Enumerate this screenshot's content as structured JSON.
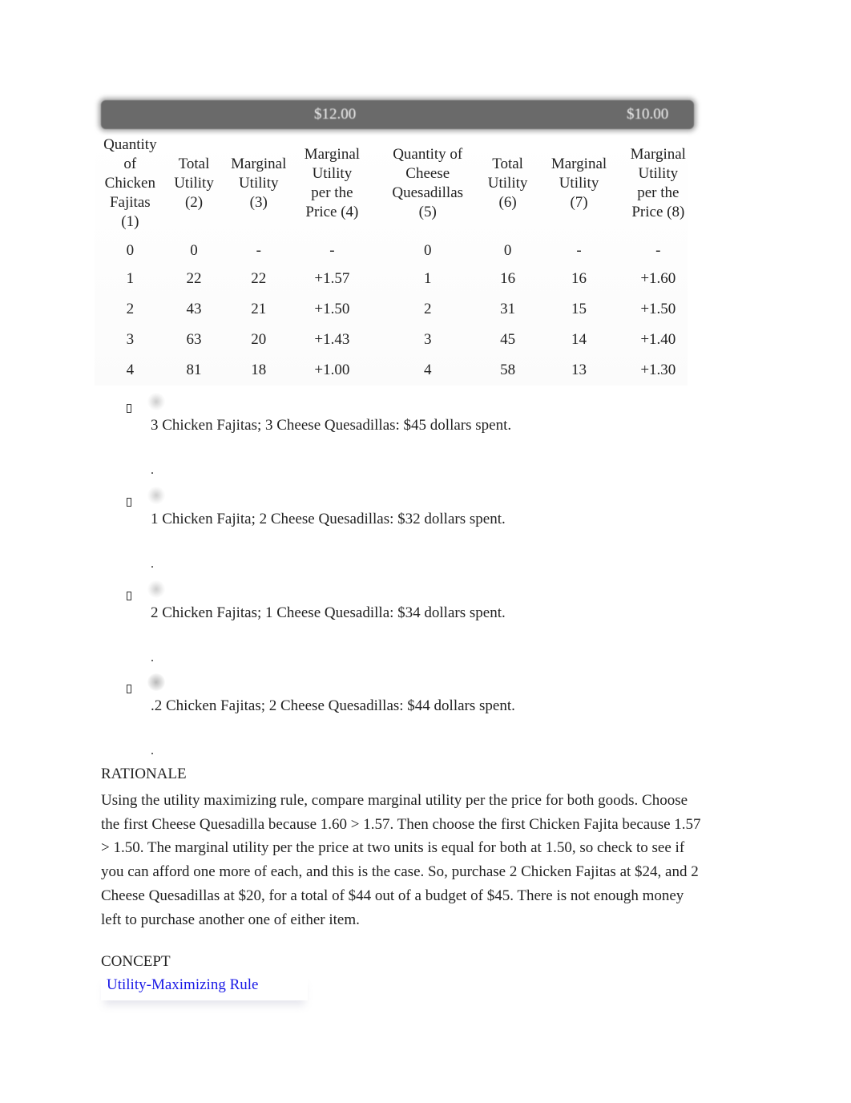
{
  "table": {
    "prices": {
      "fajitas": "$12.00",
      "quesadillas": "$10.00"
    },
    "headers": [
      "Quantity of Chicken Fajitas (1)",
      "Total Utility (2)",
      "Marginal Utility (3)",
      "Marginal Utility per the Price (4)",
      "Quantity of Cheese Quesadillas (5)",
      "Total Utility (6)",
      "Marginal Utility (7)",
      "Marginal Utility per the Price (8)"
    ],
    "header_lines": [
      [
        "Quantity",
        "of",
        "Chicken",
        "Fajitas",
        "(1)"
      ],
      [
        "Total",
        "Utility",
        "(2)"
      ],
      [
        "Marginal",
        "Utility",
        "(3)"
      ],
      [
        "Marginal",
        "Utility",
        "per the",
        "Price (4)"
      ],
      [
        "Quantity of",
        "Cheese",
        "Quesadillas",
        "(5)"
      ],
      [
        "Total",
        "Utility",
        "(6)"
      ],
      [
        "Marginal",
        "Utility",
        "(7)"
      ],
      [
        "Marginal",
        "Utility",
        "per the",
        "Price (8)"
      ]
    ],
    "rows": [
      [
        "0",
        "0",
        "-",
        "-",
        "0",
        "0",
        "-",
        "-"
      ],
      [
        "1",
        "22",
        "22",
        "+1.57",
        "1",
        "16",
        "16",
        "+1.60"
      ],
      [
        "2",
        "43",
        "21",
        "+1.50",
        "2",
        "31",
        "15",
        "+1.50"
      ],
      [
        "3",
        "63",
        "20",
        "+1.43",
        "3",
        "45",
        "14",
        "+1.40"
      ],
      [
        "4",
        "81",
        "18",
        "+1.00",
        "4",
        "58",
        "13",
        "+1.30"
      ]
    ]
  },
  "options": [
    {
      "text": "3 Chicken Fajitas; 3 Cheese Quesadillas: $45 dollars spent.",
      "trailing": "."
    },
    {
      "text": "1 Chicken Fajita; 2 Cheese Quesadillas: $32 dollars spent.",
      "trailing": "."
    },
    {
      "text": "2 Chicken Fajitas; 1 Cheese Quesadilla: $34 dollars spent.",
      "trailing": "."
    },
    {
      "text": ".2 Chicken Fajitas; 2 Cheese Quesadillas: $44 dollars spent.",
      "trailing": "."
    }
  ],
  "rationale": {
    "heading": "RATIONALE",
    "text": "Using the utility maximizing rule, compare marginal utility per the price for both goods. Choose the first Cheese Quesadilla because 1.60 > 1.57. Then choose the first Chicken Fajita because 1.57 > 1.50. The marginal utility per the price at two units is equal for both at 1.50, so check to see if you can afford one more of each, and this is the case. So, purchase 2 Chicken Fajitas at $24, and 2 Cheese Quesadillas at $20, for a total of $44 out of a budget of $45. There is not enough money left to purchase another one of either item."
  },
  "concept": {
    "heading": "CONCEPT",
    "link_label": "Utility-Maximizing Rule",
    "link_color": "#1a1ae6"
  }
}
